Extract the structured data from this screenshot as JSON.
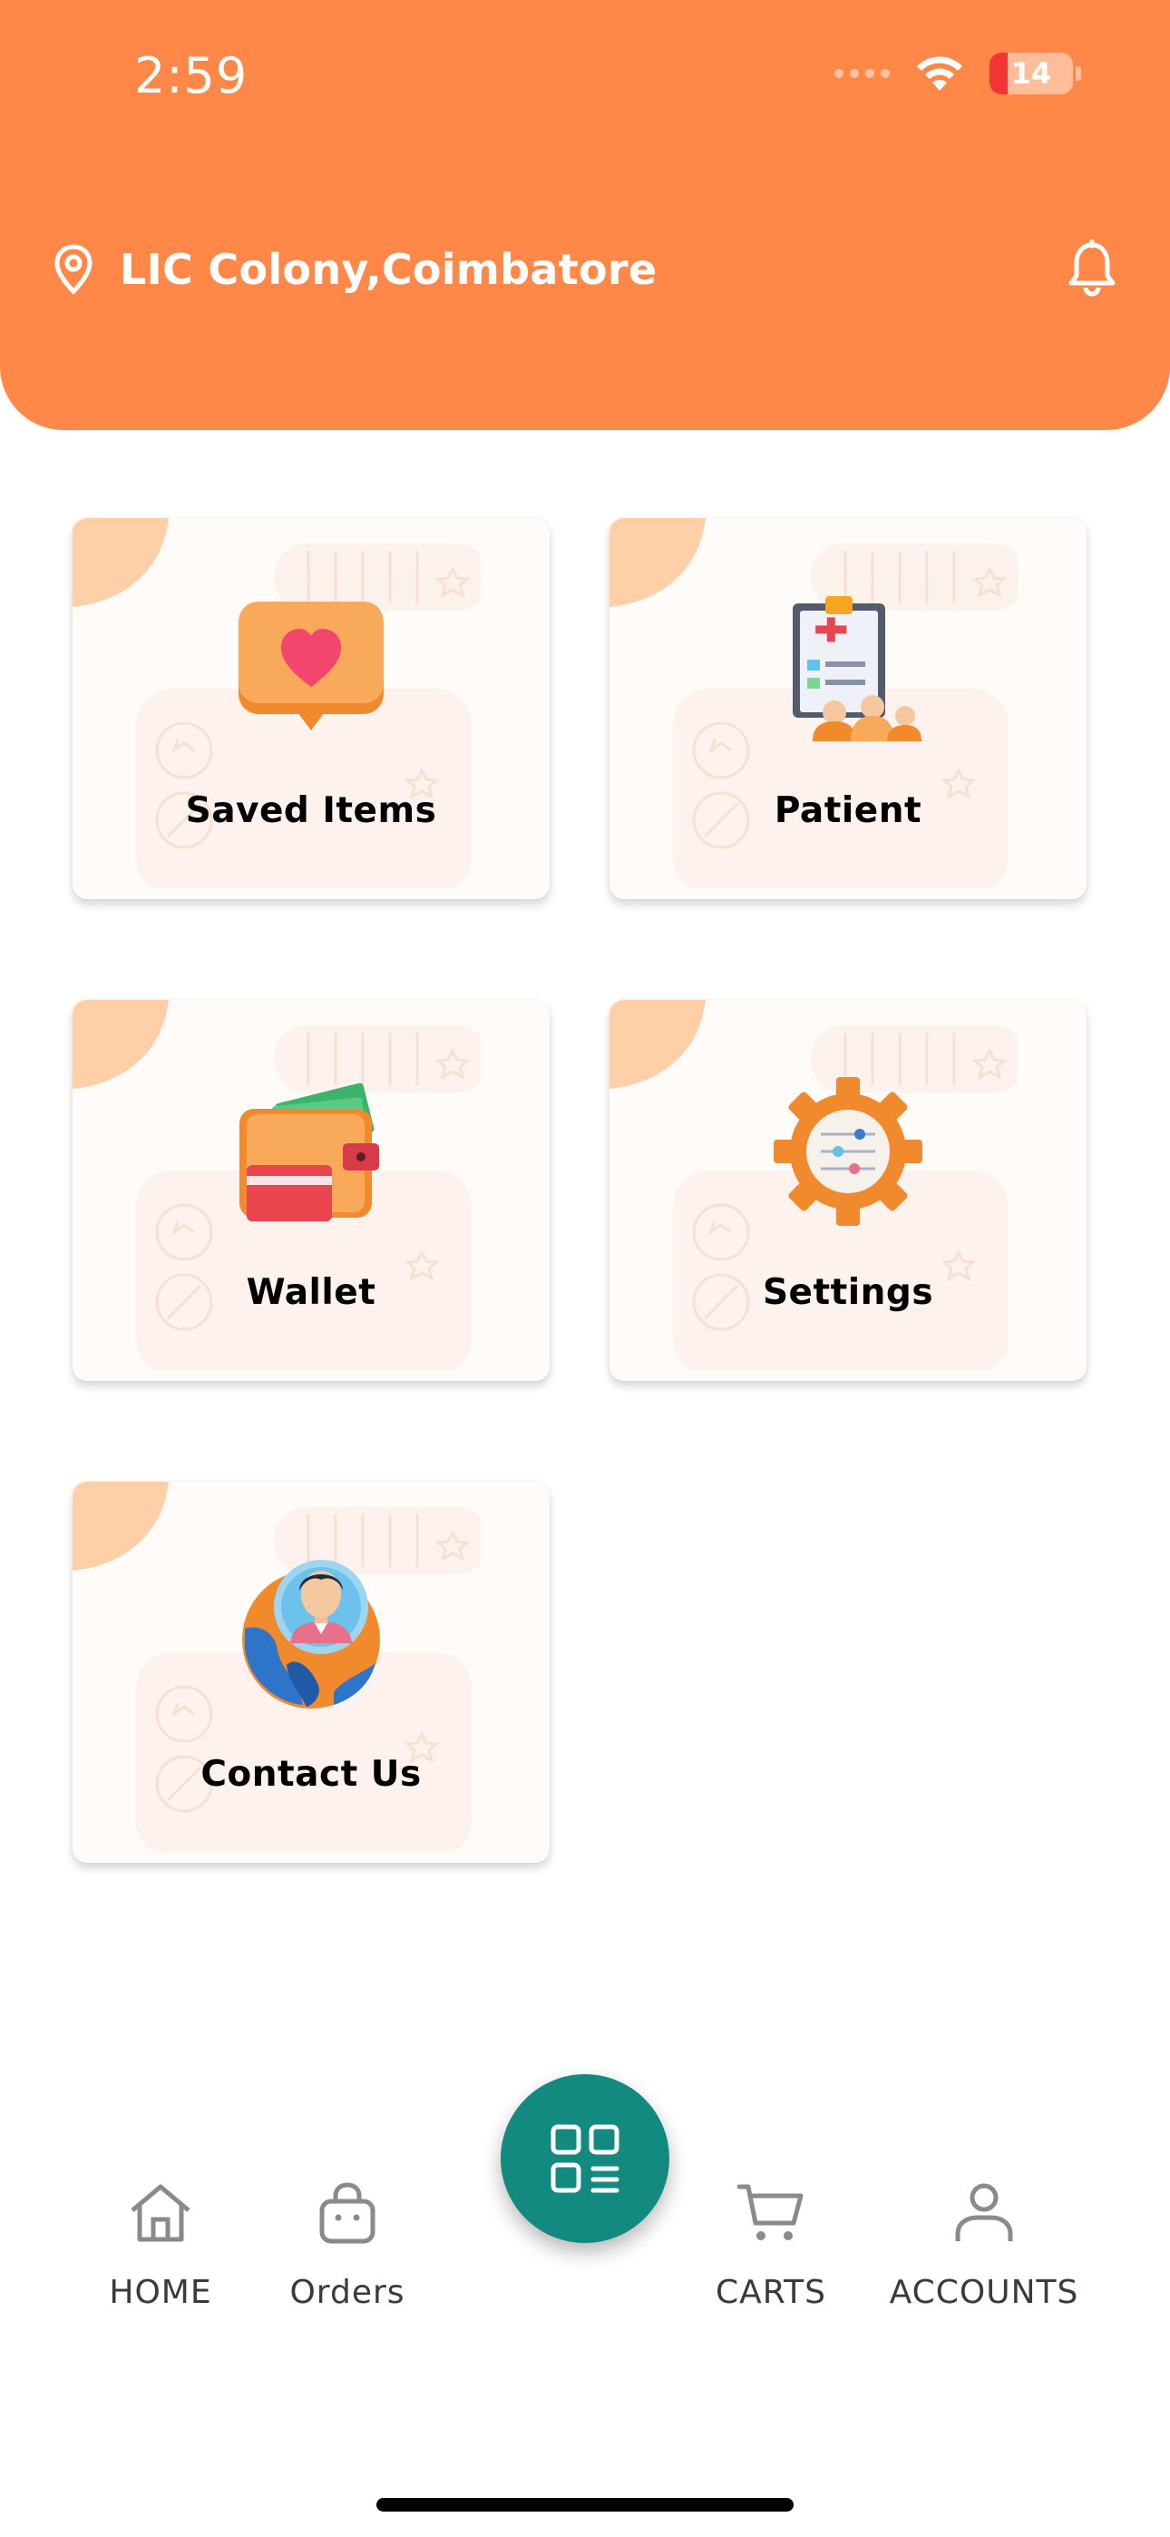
{
  "status_bar": {
    "time": "2:59",
    "battery_level": "14"
  },
  "header": {
    "location": "LIC Colony,Coimbatore"
  },
  "menu": [
    {
      "label": "Saved Items",
      "icon": "heart-chat-icon"
    },
    {
      "label": "Patient",
      "icon": "clipboard-patients-icon"
    },
    {
      "label": "Wallet",
      "icon": "wallet-icon"
    },
    {
      "label": "Settings",
      "icon": "gear-sliders-icon"
    },
    {
      "label": "Contact Us",
      "icon": "contact-globe-icon"
    }
  ],
  "bottom_nav": {
    "home": "HOME",
    "orders": "Orders",
    "carts": "CARTS",
    "accounts": "ACCOUNTS"
  },
  "colors": {
    "header": "#FF8848",
    "fab": "#138A7F",
    "card_bg": "#FEFBF9"
  }
}
